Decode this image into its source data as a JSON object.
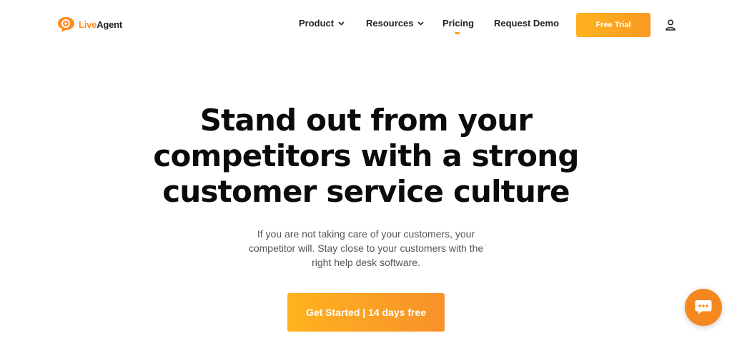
{
  "brand": {
    "name_live": "Live",
    "name_agent": "Agent"
  },
  "nav": {
    "product": "Product",
    "resources": "Resources",
    "pricing": "Pricing",
    "request_demo": "Request Demo",
    "free_trial": "Free Trial"
  },
  "hero": {
    "headline_line1": "Stand out from your",
    "headline_line2": "competitors with a strong",
    "headline_line3": "customer service culture",
    "sub_line1": "If you are not taking care of your customers, your",
    "sub_line2": "competitor will. Stay close to your customers with the",
    "sub_line3": "right help desk software.",
    "cta": "Get Started | 14 days free"
  },
  "icons": {
    "logo": "liveagent-logo-icon",
    "chevron": "chevron-down-icon",
    "user": "user-icon",
    "chat": "chat-bubble-icon"
  },
  "colors": {
    "accent": "#ff9d1f",
    "accent_dark": "#f5871f",
    "text": "#111111",
    "muted": "#555555"
  }
}
